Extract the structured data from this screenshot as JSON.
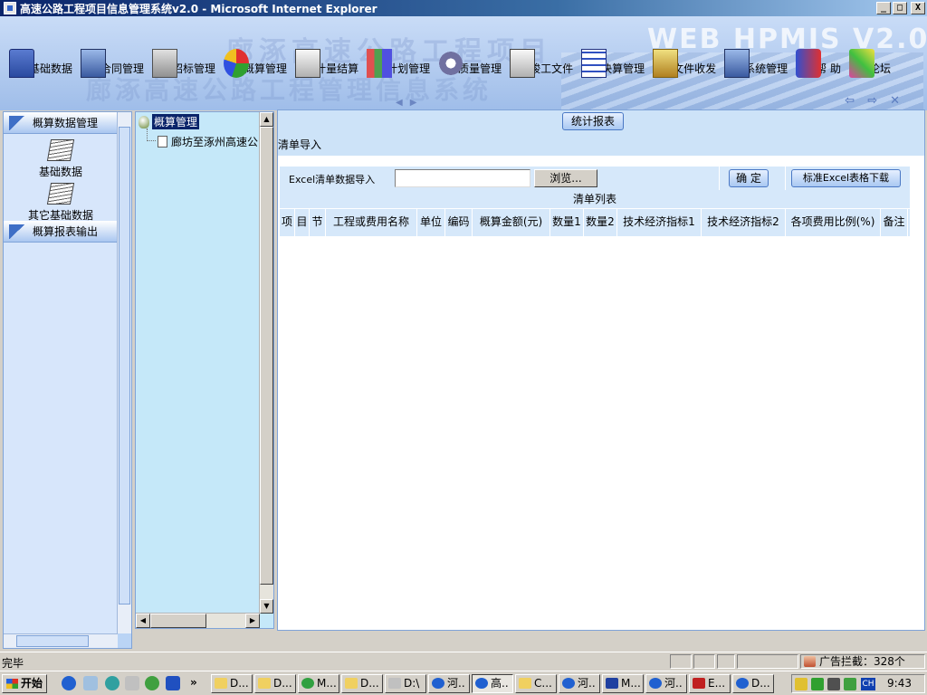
{
  "window": {
    "title": "高速公路工程项目信息管理系统v2.0 - Microsoft Internet Explorer",
    "buttons": {
      "minimize": "_",
      "maximize": "□",
      "close": "X"
    }
  },
  "banner": {
    "brand": "WEB HPMIS  V2.0",
    "watermark1": "廊涿高速公路工程项目",
    "watermark2": "廊涿高速公路工程管理信息系统"
  },
  "nav": {
    "items": [
      {
        "label": "基础数据",
        "icon": "database-icon"
      },
      {
        "label": "合同管理",
        "icon": "contract-icon"
      },
      {
        "label": "招标管理",
        "icon": "bidding-icon"
      },
      {
        "label": "概算管理",
        "icon": "pie-chart-icon"
      },
      {
        "label": "计量结算",
        "icon": "measure-icon"
      },
      {
        "label": "计划管理",
        "icon": "plan-chart-icon"
      },
      {
        "label": "质量管理",
        "icon": "gear-icon"
      },
      {
        "label": "竣工文件",
        "icon": "file-icon"
      },
      {
        "label": "决算管理",
        "icon": "calculator-icon"
      },
      {
        "label": "文件收发",
        "icon": "mail-icon"
      },
      {
        "label": "系统管理",
        "icon": "computer-icon"
      },
      {
        "label": "帮 助",
        "icon": "help-icon"
      },
      {
        "label": "论坛",
        "icon": "forum-icon"
      }
    ]
  },
  "sidebar": {
    "section1": "概算数据管理",
    "tiles": [
      {
        "label": "基础数据"
      },
      {
        "label": "其它基础数据"
      }
    ],
    "section2": "概算报表输出"
  },
  "tree": {
    "root": "概算管理",
    "child": "廊坊至涿州高速公"
  },
  "main": {
    "stats_button": "统计报表",
    "section_title": "清单导入",
    "import_label": "Excel清单数据导入",
    "file_value": "",
    "browse_button": "浏览...",
    "confirm_button": "确 定",
    "download_button": "标准Excel表格下载",
    "list_title": "清单列表",
    "columns": [
      "项",
      "目",
      "节",
      "工程或费用名称",
      "单位",
      "编码",
      "概算金额(元)",
      "数量1",
      "数量2",
      "技术经济指标1",
      "技术经济指标2",
      "各项费用比例(%)",
      "备注"
    ]
  },
  "status": {
    "text": "完毕",
    "adblock": "广告拦截：328个"
  },
  "taskbar": {
    "start": "开始",
    "more": "»",
    "tasks": [
      {
        "label": "D...",
        "color": "#f0d060"
      },
      {
        "label": "D...",
        "color": "#f0d060"
      },
      {
        "label": "M...",
        "color": "#30a040"
      },
      {
        "label": "D...",
        "color": "#f0d060"
      },
      {
        "label": "D:\\",
        "color": "#c0c0c0"
      },
      {
        "label": "河..",
        "color": "#2060d0"
      },
      {
        "label": "高..",
        "color": "#2060d0"
      },
      {
        "label": "C...",
        "color": "#f0d060"
      },
      {
        "label": "河..",
        "color": "#2060d0"
      },
      {
        "label": "M...",
        "color": "#2040a0"
      },
      {
        "label": "河..",
        "color": "#2060d0"
      },
      {
        "label": "E...",
        "color": "#c02020"
      },
      {
        "label": "D...",
        "color": "#2060d0"
      }
    ],
    "tray_lang": "CH",
    "clock": "9:43"
  }
}
